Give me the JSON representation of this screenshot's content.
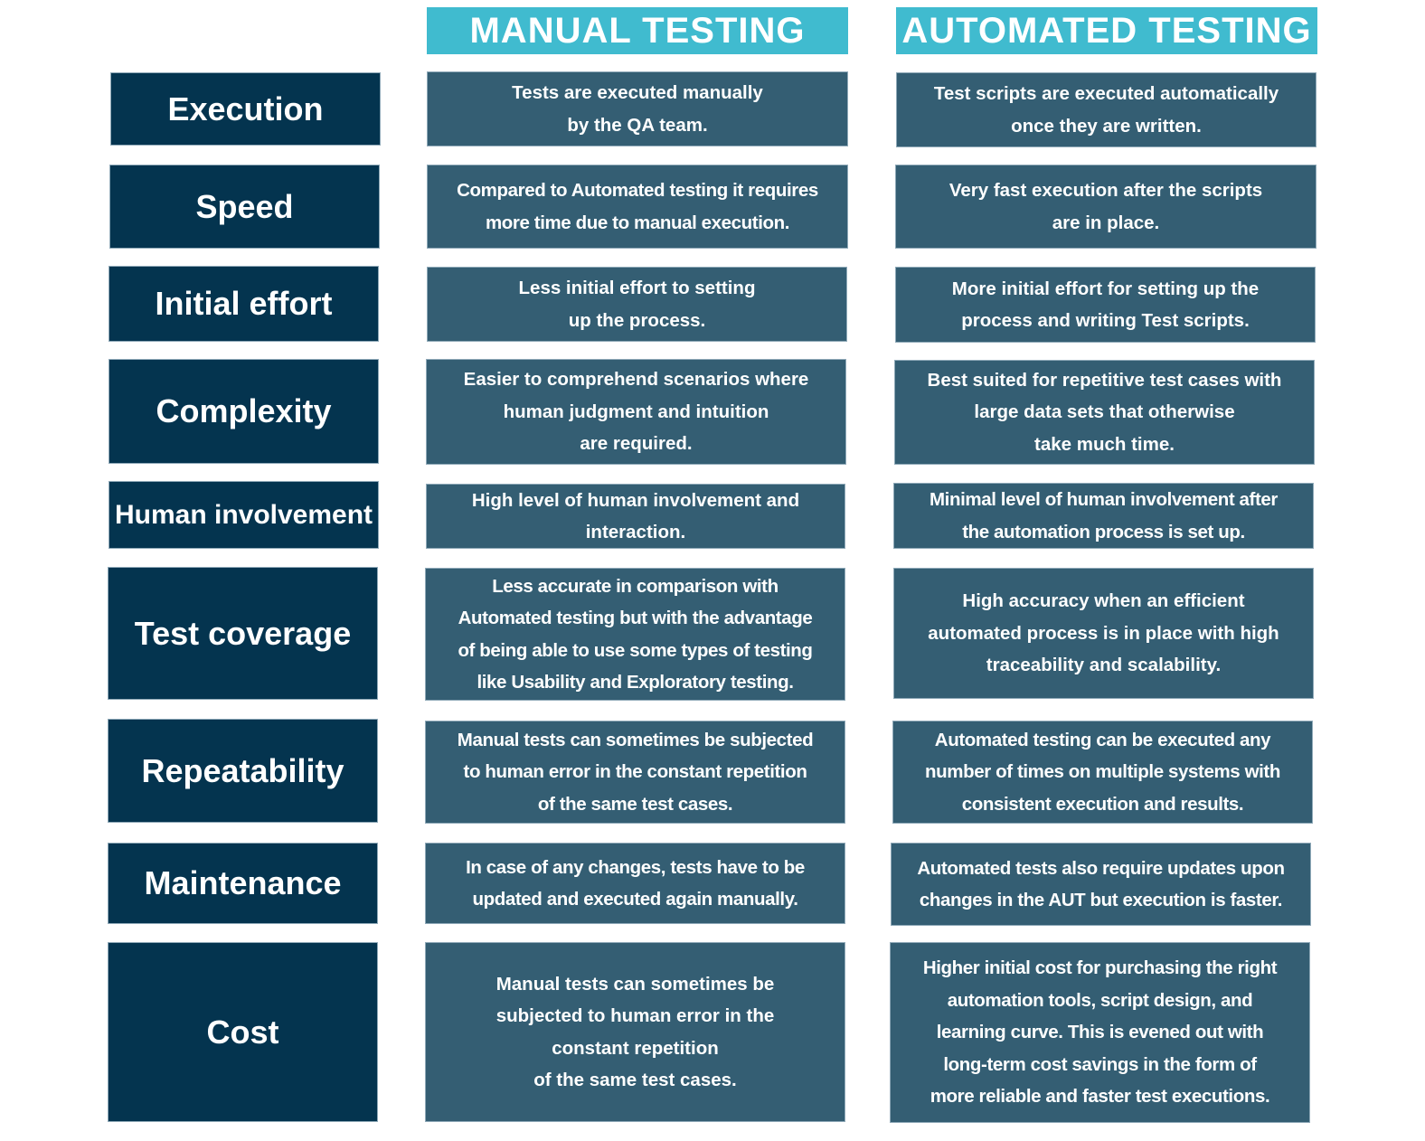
{
  "headers": {
    "manual": "MANUAL TESTING",
    "automated": "AUTOMATED TESTING"
  },
  "colors": {
    "header_bg": "#40bbcf",
    "label_bg": "#04344f",
    "cell_bg": "#345e73",
    "text": "#ffffff"
  },
  "rows": [
    {
      "label": "Execution",
      "manual": "Tests are executed manually\nby the QA team.",
      "automated": "Test scripts are executed automatically\nonce they are written."
    },
    {
      "label": "Speed",
      "manual": "Compared to Automated testing it requires\nmore time due to manual execution.",
      "automated": "Very fast execution after the scripts\nare in place."
    },
    {
      "label": "Initial effort",
      "manual": "Less initial effort to setting\nup the process.",
      "automated": "More initial effort for setting up the\nprocess and writing Test scripts."
    },
    {
      "label": "Complexity",
      "manual": "Easier to comprehend scenarios where\nhuman judgment and intuition\nare required.",
      "automated": "Best suited for repetitive test cases with\nlarge data sets that otherwise\ntake much time."
    },
    {
      "label": "Human involvement",
      "manual": "High level of human involvement and\ninteraction.",
      "automated": "Minimal level of human involvement after\nthe automation process is set up."
    },
    {
      "label": "Test coverage",
      "manual": "Less accurate in comparison with\nAutomated testing but with the advantage\nof being able to use some types of testing\nlike Usability and Exploratory testing.",
      "automated": "High accuracy when an efficient\nautomated process is in place with high\ntraceability and scalability."
    },
    {
      "label": "Repeatability",
      "manual": "Manual tests can sometimes be subjected\nto human error in the constant repetition\nof the same test cases.",
      "automated": "Automated testing can be executed any\nnumber of times on multiple systems with\nconsistent execution and results."
    },
    {
      "label": "Maintenance",
      "manual": "In case of any changes, tests have to be\nupdated and executed again manually.",
      "automated": "Automated tests also require updates upon\nchanges in the AUT but execution is faster."
    },
    {
      "label": "Cost",
      "manual": "Manual tests can sometimes be\nsubjected to human error in the\nconstant repetition\nof the same test cases.",
      "automated": "Higher initial cost for purchasing the right\nautomation tools, script design, and\nlearning curve. This is evened out with\nlong-term cost savings in the form of\nmore reliable and faster test executions."
    }
  ]
}
